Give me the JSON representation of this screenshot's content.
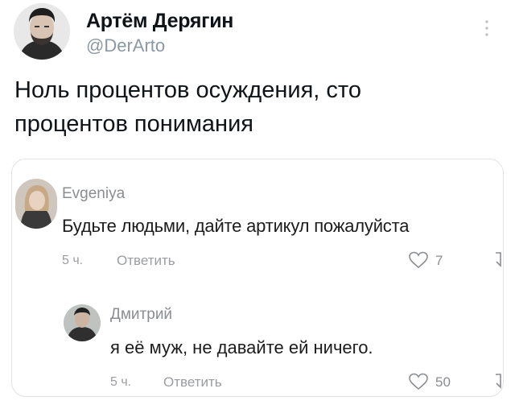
{
  "author": {
    "name": "Артём Дерягин",
    "handle": "@DerArto",
    "avatar_icon": "user-photo-avatar",
    "more_icon": "more-vertical-icon"
  },
  "tweet": {
    "text_line1": "Ноль процентов осуждения, сто",
    "text_line2": "процентов понимания"
  },
  "comments": [
    {
      "author": "Evgeniya",
      "text": "Будьте людьми, дайте артикул пожалуйста",
      "time": "5 ч.",
      "reply_label": "Ответить",
      "likes": "7",
      "avatar_icon": "user-photo-avatar"
    },
    {
      "author": "Дмитрий",
      "text": "я её муж, не давайте ей ничего.",
      "time": "5 ч.",
      "reply_label": "Ответить",
      "likes": "50",
      "avatar_icon": "user-photo-avatar"
    }
  ],
  "colors": {
    "text": "#0f1419",
    "muted": "#8b98a5",
    "card_border": "#dfe3e6"
  }
}
